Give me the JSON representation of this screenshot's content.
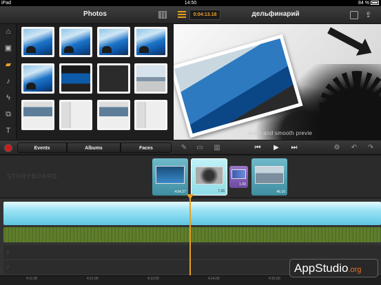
{
  "status": {
    "device": "iPad",
    "time": "14:50",
    "battery": "84 %"
  },
  "header": {
    "photos_title": "Photos",
    "timecode": "0:04:13.18",
    "project_title": "дельфинарий"
  },
  "sidebar": {
    "items": [
      {
        "icon": "home-icon"
      },
      {
        "icon": "film-icon"
      },
      {
        "icon": "photos-icon"
      },
      {
        "icon": "music-note-icon"
      },
      {
        "icon": "lightning-icon"
      },
      {
        "icon": "titles-icon"
      },
      {
        "icon": "text-icon"
      }
    ]
  },
  "preview": {
    "caption": "urate and smooth previe"
  },
  "toolbar": {
    "tabs": [
      "Events",
      "Albums",
      "Faces"
    ],
    "accent": "#f0a030",
    "record_color": "#c81e1e"
  },
  "storyboard": {
    "label": "STORYBOARD",
    "clips": [
      {
        "duration": "4:04.27"
      },
      {
        "duration": "7.26"
      },
      {
        "duration": "1.00"
      },
      {
        "duration": "46.16"
      }
    ]
  },
  "ruler": {
    "ticks": [
      "4:11.00",
      "4:12.00",
      "4:13.00",
      "4:14.00",
      "4:15.00"
    ]
  },
  "watermark": {
    "main": "AppStudio",
    "suffix": ".org"
  }
}
